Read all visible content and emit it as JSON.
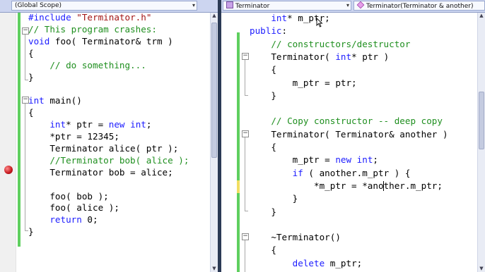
{
  "left_pane": {
    "scope_dropdown": "(Global Scope)",
    "lines": [
      {
        "id": "l1",
        "segments": [
          {
            "t": "#include ",
            "c": "kw"
          },
          {
            "t": "\"Terminator.h\"",
            "c": "str"
          }
        ]
      },
      {
        "id": "l2",
        "segments": [
          {
            "t": "// This program crashes:",
            "c": "cm"
          }
        ]
      },
      {
        "id": "l3",
        "segments": [
          {
            "t": "void",
            "c": "kw"
          },
          {
            "t": " foo( Terminator& trm )",
            "c": ""
          }
        ]
      },
      {
        "id": "l4",
        "segments": [
          {
            "t": "{",
            "c": ""
          }
        ]
      },
      {
        "id": "l5",
        "segments": [
          {
            "t": "    // do something...",
            "c": "cm"
          }
        ]
      },
      {
        "id": "l6",
        "segments": [
          {
            "t": "}",
            "c": ""
          }
        ]
      },
      {
        "id": "l7",
        "segments": []
      },
      {
        "id": "l8",
        "segments": [
          {
            "t": "int",
            "c": "kw"
          },
          {
            "t": " main()",
            "c": ""
          }
        ]
      },
      {
        "id": "l9",
        "segments": [
          {
            "t": "{",
            "c": ""
          }
        ]
      },
      {
        "id": "l10",
        "segments": [
          {
            "t": "    ",
            "c": ""
          },
          {
            "t": "int",
            "c": "kw"
          },
          {
            "t": "* ptr = ",
            "c": ""
          },
          {
            "t": "new",
            "c": "kw"
          },
          {
            "t": " ",
            "c": ""
          },
          {
            "t": "int",
            "c": "kw"
          },
          {
            "t": ";",
            "c": ""
          }
        ]
      },
      {
        "id": "l11",
        "segments": [
          {
            "t": "    *ptr = 12345;",
            "c": ""
          }
        ]
      },
      {
        "id": "l12",
        "segments": [
          {
            "t": "    Terminator alice( ptr );",
            "c": ""
          }
        ]
      },
      {
        "id": "l13",
        "segments": [
          {
            "t": "    //Terminator bob( alice );",
            "c": "cm"
          }
        ]
      },
      {
        "id": "l14",
        "segments": [
          {
            "t": "    Terminator bob = alice;",
            "c": ""
          }
        ]
      },
      {
        "id": "l15",
        "segments": []
      },
      {
        "id": "l16",
        "segments": [
          {
            "t": "    foo( bob );",
            "c": ""
          }
        ]
      },
      {
        "id": "l17",
        "segments": [
          {
            "t": "    foo( alice );",
            "c": ""
          }
        ]
      },
      {
        "id": "l18",
        "segments": [
          {
            "t": "    ",
            "c": ""
          },
          {
            "t": "return",
            "c": "kw"
          },
          {
            "t": " 0;",
            "c": ""
          }
        ]
      },
      {
        "id": "l19",
        "segments": [
          {
            "t": "}",
            "c": ""
          }
        ]
      }
    ]
  },
  "right_pane": {
    "class_dropdown": "Terminator",
    "member_dropdown": "Terminator(Terminator & another)",
    "lines": [
      {
        "id": "r1",
        "segments": [
          {
            "t": "    ",
            "c": ""
          },
          {
            "t": "int",
            "c": "kw"
          },
          {
            "t": "* m_ptr;",
            "c": ""
          }
        ]
      },
      {
        "id": "r2",
        "segments": [
          {
            "t": "public",
            "c": "kw"
          },
          {
            "t": ":",
            "c": ""
          }
        ]
      },
      {
        "id": "r3",
        "segments": [
          {
            "t": "    // constructors/destructor",
            "c": "cm"
          }
        ]
      },
      {
        "id": "r4",
        "segments": [
          {
            "t": "    Terminator( ",
            "c": ""
          },
          {
            "t": "int",
            "c": "kw"
          },
          {
            "t": "* ptr )",
            "c": ""
          }
        ]
      },
      {
        "id": "r5",
        "segments": [
          {
            "t": "    {",
            "c": ""
          }
        ]
      },
      {
        "id": "r6",
        "segments": [
          {
            "t": "        m_ptr = ptr;",
            "c": ""
          }
        ]
      },
      {
        "id": "r7",
        "segments": [
          {
            "t": "    }",
            "c": ""
          }
        ]
      },
      {
        "id": "r8",
        "segments": []
      },
      {
        "id": "r9",
        "segments": [
          {
            "t": "    // Copy constructor -- deep copy",
            "c": "cm"
          }
        ]
      },
      {
        "id": "r10",
        "segments": [
          {
            "t": "    Terminator( Terminator& another )",
            "c": ""
          }
        ]
      },
      {
        "id": "r11",
        "segments": [
          {
            "t": "    {",
            "c": ""
          }
        ]
      },
      {
        "id": "r12",
        "segments": [
          {
            "t": "        m_ptr = ",
            "c": ""
          },
          {
            "t": "new",
            "c": "kw"
          },
          {
            "t": " ",
            "c": ""
          },
          {
            "t": "int",
            "c": "kw"
          },
          {
            "t": ";",
            "c": ""
          }
        ]
      },
      {
        "id": "r13",
        "segments": [
          {
            "t": "        ",
            "c": ""
          },
          {
            "t": "if",
            "c": "kw"
          },
          {
            "t": " ( another.m_ptr ) {",
            "c": ""
          }
        ]
      },
      {
        "id": "r14",
        "segments": [
          {
            "t": "            *m_ptr = *ano",
            "c": ""
          },
          {
            "t": "|",
            "c": "caret"
          },
          {
            "t": "ther.m_ptr;",
            "c": ""
          }
        ]
      },
      {
        "id": "r15",
        "segments": [
          {
            "t": "        }",
            "c": ""
          }
        ]
      },
      {
        "id": "r16",
        "segments": [
          {
            "t": "    }",
            "c": ""
          }
        ]
      },
      {
        "id": "r17",
        "segments": []
      },
      {
        "id": "r18",
        "segments": [
          {
            "t": "    ~Terminator()",
            "c": ""
          }
        ]
      },
      {
        "id": "r19",
        "segments": [
          {
            "t": "    {",
            "c": ""
          }
        ]
      },
      {
        "id": "r20",
        "segments": [
          {
            "t": "        ",
            "c": ""
          },
          {
            "t": "delete",
            "c": "kw"
          },
          {
            "t": " m_ptr;",
            "c": ""
          }
        ]
      }
    ]
  },
  "icons": {
    "breakpoint": "breakpoint-icon",
    "collapse": "collapse-icon",
    "mouse": "mouse-pointer-icon"
  },
  "colors": {
    "keyword": "#1c1cff",
    "comment": "#1f8f1f",
    "string": "#a31515",
    "change_saved": "#5fcf5f",
    "change_unsaved": "#f2de62",
    "breakpoint": "#c4161c"
  }
}
